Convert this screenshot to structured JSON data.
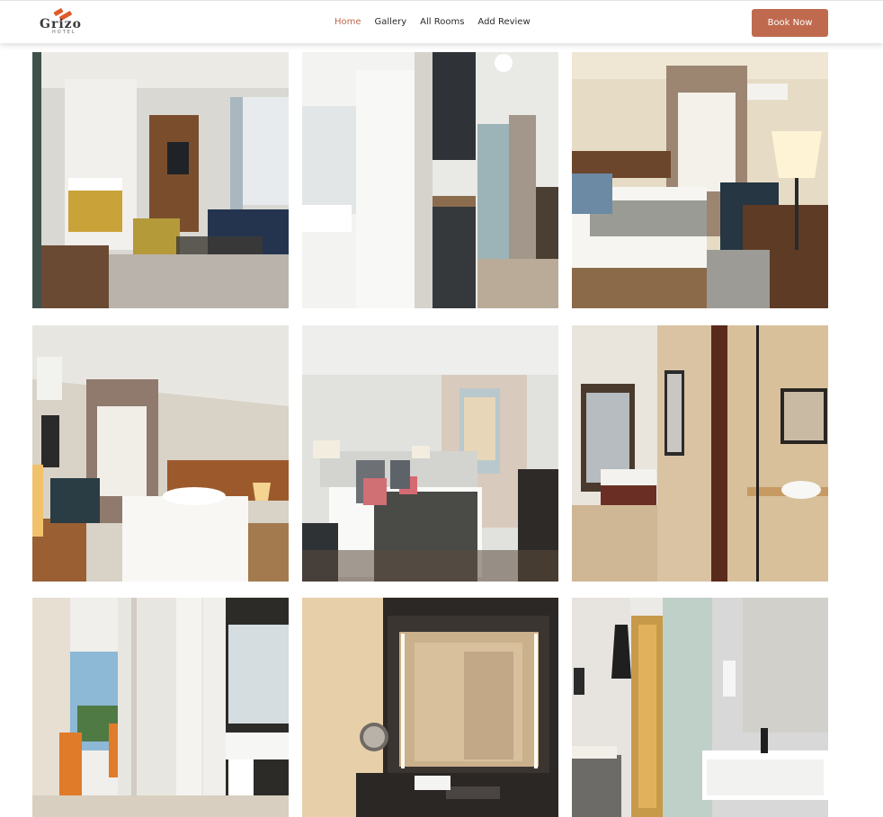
{
  "brand": {
    "name": "Grizo",
    "tagline": "HOTEL",
    "logo_mark_color": "#e05a2b"
  },
  "nav": {
    "links": [
      {
        "label": "Home",
        "active": true
      },
      {
        "label": "Gallery",
        "active": false
      },
      {
        "label": "All Rooms",
        "active": false
      },
      {
        "label": "Add Review",
        "active": false
      }
    ],
    "cta_label": "Book Now",
    "cta_color": "#bf6a4f",
    "active_color": "#c06a4e"
  },
  "gallery": {
    "photos": [
      {
        "subject": "hotel room lounge with yellow armchair and navy sofa"
      },
      {
        "subject": "hotel room kitchenette and bathroom door"
      },
      {
        "subject": "hotel room bed with grey throw and desk lamp"
      },
      {
        "subject": "hotel room double bed with wooden headboard"
      },
      {
        "subject": "hotel room bed with pink pillows and grey throw"
      },
      {
        "subject": "hotel room bathroom with vessel sink and shower"
      },
      {
        "subject": "hotel corridor with orange chairs and bathroom"
      },
      {
        "subject": "hotel bathroom mirror with marble walls"
      },
      {
        "subject": "hotel bathroom with white sink and glass shower"
      }
    ]
  }
}
